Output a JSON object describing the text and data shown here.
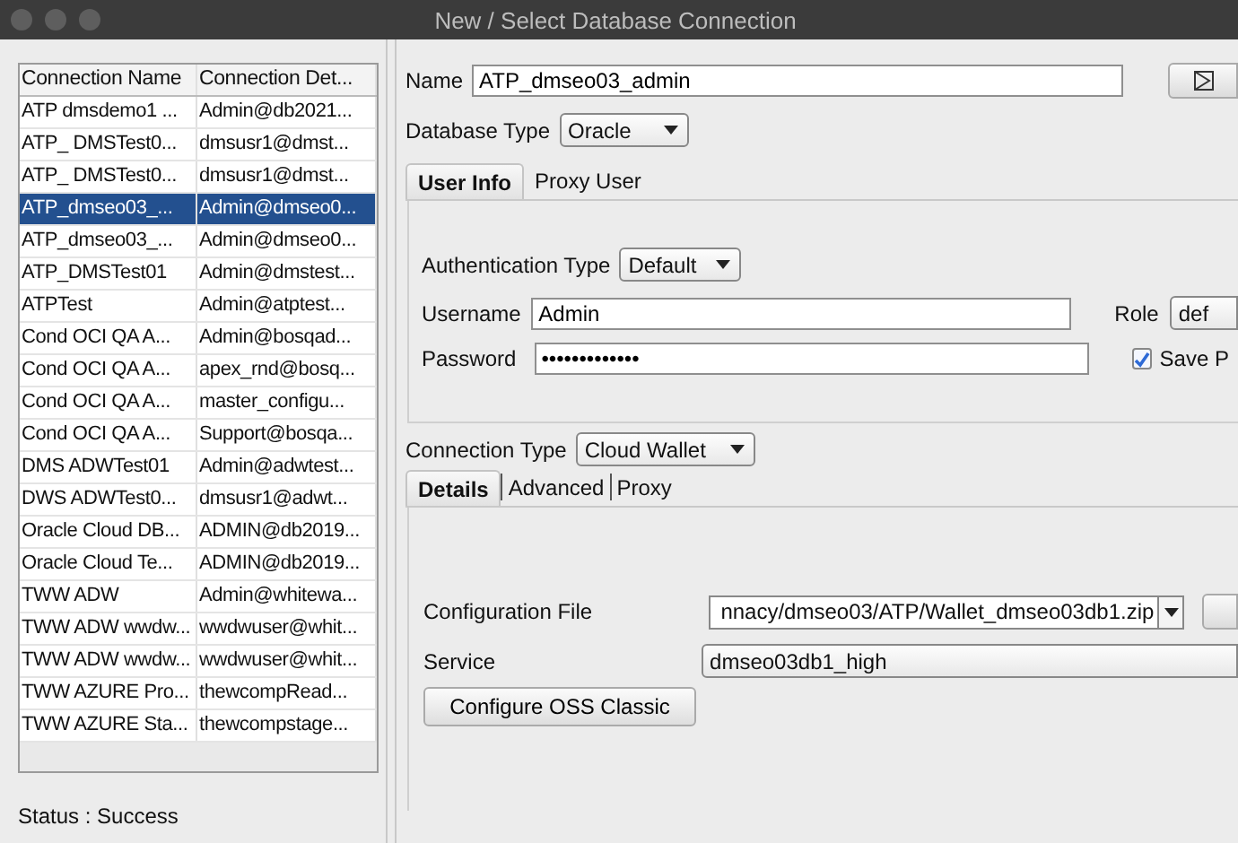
{
  "window": {
    "title": "New / Select Database Connection"
  },
  "connections": {
    "columns": [
      "Connection Name",
      "Connection Det..."
    ],
    "rows": [
      {
        "name": "ATP dmsdemo1 ...",
        "details": "Admin@db2021...",
        "selected": false
      },
      {
        "name": "ATP_ DMSTest0...",
        "details": "dmsusr1@dmst...",
        "selected": false
      },
      {
        "name": "ATP_ DMSTest0...",
        "details": "dmsusr1@dmst...",
        "selected": false
      },
      {
        "name": "ATP_dmseo03_...",
        "details": "Admin@dmseo0...",
        "selected": true
      },
      {
        "name": "ATP_dmseo03_...",
        "details": "Admin@dmseo0...",
        "selected": false
      },
      {
        "name": "ATP_DMSTest01",
        "details": "Admin@dmstest...",
        "selected": false
      },
      {
        "name": "ATPTest",
        "details": "Admin@atptest...",
        "selected": false
      },
      {
        "name": "Cond OCI QA A...",
        "details": "Admin@bosqad...",
        "selected": false
      },
      {
        "name": "Cond OCI QA A...",
        "details": "apex_rnd@bosq...",
        "selected": false
      },
      {
        "name": "Cond OCI QA A...",
        "details": "master_configu...",
        "selected": false
      },
      {
        "name": "Cond OCI QA A...",
        "details": "Support@bosqa...",
        "selected": false
      },
      {
        "name": "DMS ADWTest01",
        "details": "Admin@adwtest...",
        "selected": false
      },
      {
        "name": "DWS ADWTest0...",
        "details": "dmsusr1@adwt...",
        "selected": false
      },
      {
        "name": "Oracle Cloud DB...",
        "details": "ADMIN@db2019...",
        "selected": false
      },
      {
        "name": "Oracle Cloud Te...",
        "details": "ADMIN@db2019...",
        "selected": false
      },
      {
        "name": "TWW ADW",
        "details": "Admin@whitewa...",
        "selected": false
      },
      {
        "name": "TWW ADW wwdw...",
        "details": "wwdwuser@whit...",
        "selected": false
      },
      {
        "name": "TWW ADW wwdw...",
        "details": "wwdwuser@whit...",
        "selected": false
      },
      {
        "name": "TWW AZURE Pro...",
        "details": "thewcompRead...",
        "selected": false
      },
      {
        "name": "TWW AZURE Sta...",
        "details": "thewcompstage...",
        "selected": false
      }
    ]
  },
  "status": "Status : Success",
  "name_field": {
    "label": "Name",
    "value": "ATP_dmseo03_admin"
  },
  "database_type": {
    "label": "Database Type",
    "value": "Oracle"
  },
  "user_tabs": [
    {
      "label": "User Info",
      "selected": true
    },
    {
      "label": "Proxy User",
      "selected": false
    }
  ],
  "authentication_type": {
    "label": "Authentication Type",
    "value": "Default"
  },
  "username": {
    "label": "Username",
    "value": "Admin"
  },
  "password": {
    "label": "Password",
    "value": "•••••••••••••"
  },
  "role": {
    "label": "Role",
    "value": "def"
  },
  "save_password": {
    "label": "Save P",
    "checked": true
  },
  "connection_type": {
    "label": "Connection Type",
    "value": "Cloud Wallet"
  },
  "connection_tabs": [
    {
      "label": "Details",
      "selected": true
    },
    {
      "label": "Advanced",
      "selected": false
    },
    {
      "label": "Proxy",
      "selected": false
    }
  ],
  "configuration_file": {
    "label": "Configuration File",
    "value": "nnacy/dmseo03/ATP/Wallet_dmseo03db1.zip"
  },
  "service": {
    "label": "Service",
    "value": "dmseo03db1_high"
  },
  "configure_button": {
    "label": "Configure OSS Classic"
  }
}
